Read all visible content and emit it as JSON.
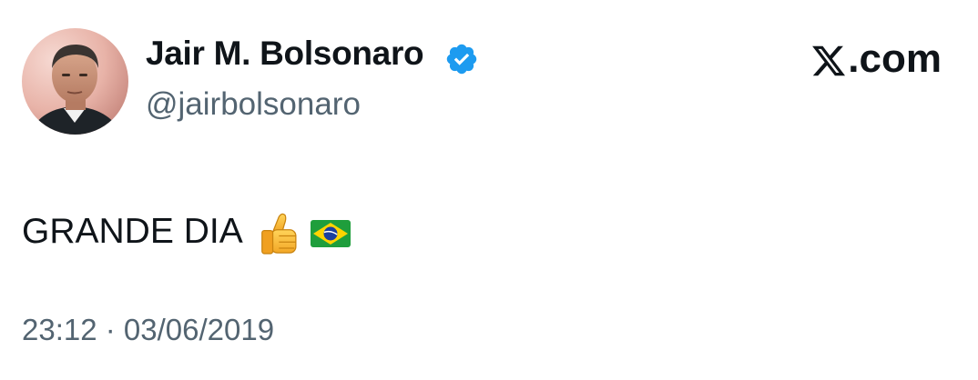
{
  "author": {
    "display_name": "Jair M. Bolsonaro",
    "handle": "@jairbolsonaro",
    "verified": true,
    "verified_color": "#1d9bf0",
    "avatar_icon": "profile-photo"
  },
  "brand": {
    "logo": "x-logo",
    "text": ".com"
  },
  "post": {
    "text": "GRANDE DIA",
    "emojis": [
      "thumbs-up-icon",
      "brazil-flag-icon"
    ]
  },
  "meta": {
    "timestamp": "23:12 · 03/06/2019",
    "text_color": "#536471"
  }
}
